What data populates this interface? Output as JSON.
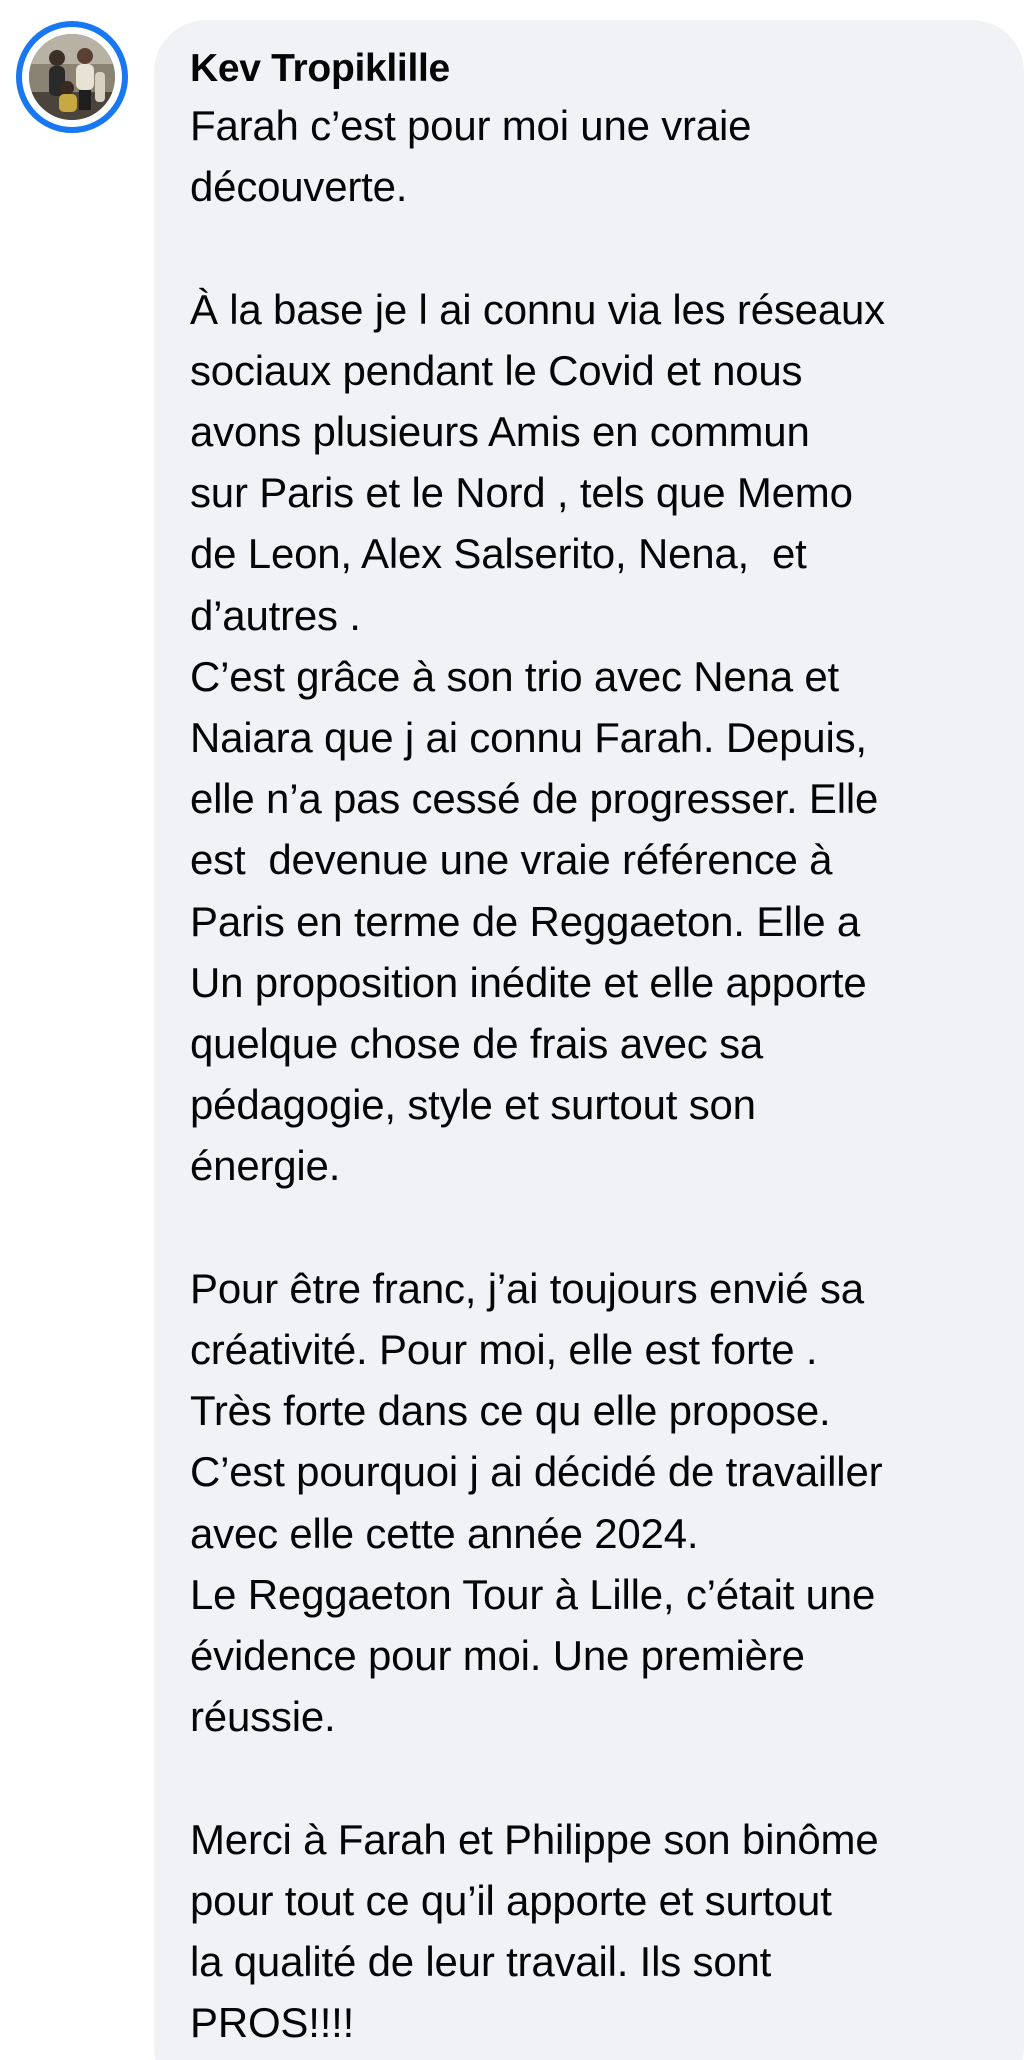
{
  "comment": {
    "author": "Kev Tropiklille",
    "text": "Farah c’est pour moi une vraie\ndécouverte.\n\nÀ la base je l ai connu via les réseaux\nsociaux pendant le Covid et nous\navons plusieurs Amis en commun\nsur Paris et le Nord , tels que Memo\nde Leon, Alex Salserito, Nena,  et\nd’autres .\nC’est grâce à son trio avec Nena et\nNaiara que j ai connu Farah. Depuis,\nelle n’a pas cessé de progresser. Elle\nest  devenue une vraie référence à\nParis en terme de Reggaeton. Elle a\nUn proposition inédite et elle apporte\nquelque chose de frais avec sa\npédagogie, style et surtout son\nénergie.\n\nPour être franc, j’ai toujours envié sa\ncréativité. Pour moi, elle est forte .\nTrès forte dans ce qu elle propose.\nC’est pourquoi j ai décidé de travailler\navec elle cette année 2024.\nLe Reggaeton Tour à Lille, c’était une\névidence pour moi. Une première\nréussie.\n\nMerci à Farah et Philippe son binôme\npour tout ce qu’il apporte et surtout\nla qualité de leur travail. Ils sont\nPROS!!!!"
  },
  "avatar": {
    "icon": "profile-photo",
    "ring_color": "#1877f2"
  },
  "colors": {
    "bubble": "#f0f2f5",
    "text": "#050505"
  }
}
